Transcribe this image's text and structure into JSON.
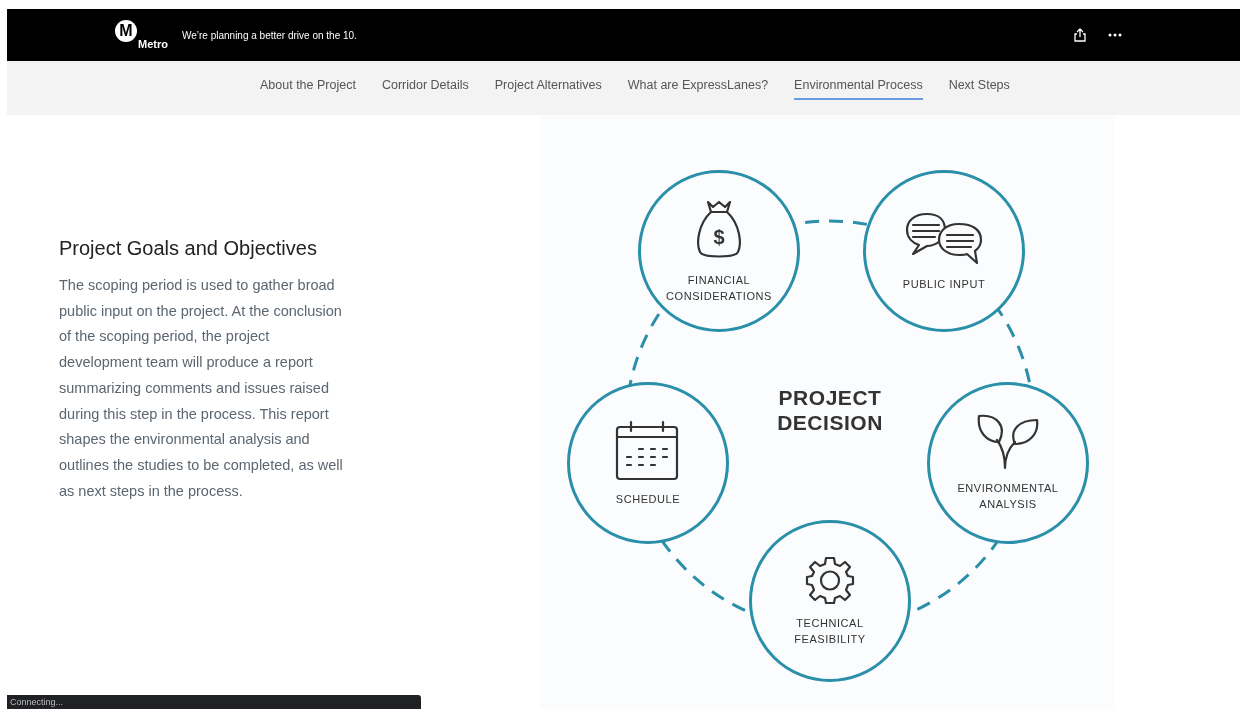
{
  "header": {
    "logo_letter": "M",
    "logo_text": "Metro",
    "tagline": "We’re planning a better drive on the 10."
  },
  "nav": [
    {
      "label": "About the Project",
      "selected": false
    },
    {
      "label": "Corridor Details",
      "selected": false
    },
    {
      "label": "Project Alternatives",
      "selected": false
    },
    {
      "label": "What are ExpressLanes?",
      "selected": false
    },
    {
      "label": "Environmental Process",
      "selected": true
    },
    {
      "label": "Next Steps",
      "selected": false
    }
  ],
  "section": {
    "title": "Project Goals and Objectives",
    "body": "The scoping period is used to gather broad public input on the project. At the conclusion of the scoping period, the project development team will produce a report summarizing comments and issues raised during this step in the process. This report shapes the environmental analysis and outlines the studies to be completed, as well as next steps in the process."
  },
  "diagram": {
    "center": "PROJECT DECISION",
    "nodes": [
      {
        "label": "FINANCIAL CONSIDERATIONS",
        "kind": "money",
        "symbol": "$"
      },
      {
        "label": "PUBLIC INPUT",
        "kind": "speech"
      },
      {
        "label": "ENVIRONMENTAL ANALYSIS",
        "kind": "plant"
      },
      {
        "label": "TECHNICAL FEASIBILITY",
        "kind": "gear"
      },
      {
        "label": "SCHEDULE",
        "kind": "calendar"
      }
    ]
  },
  "status": "Connecting..."
}
